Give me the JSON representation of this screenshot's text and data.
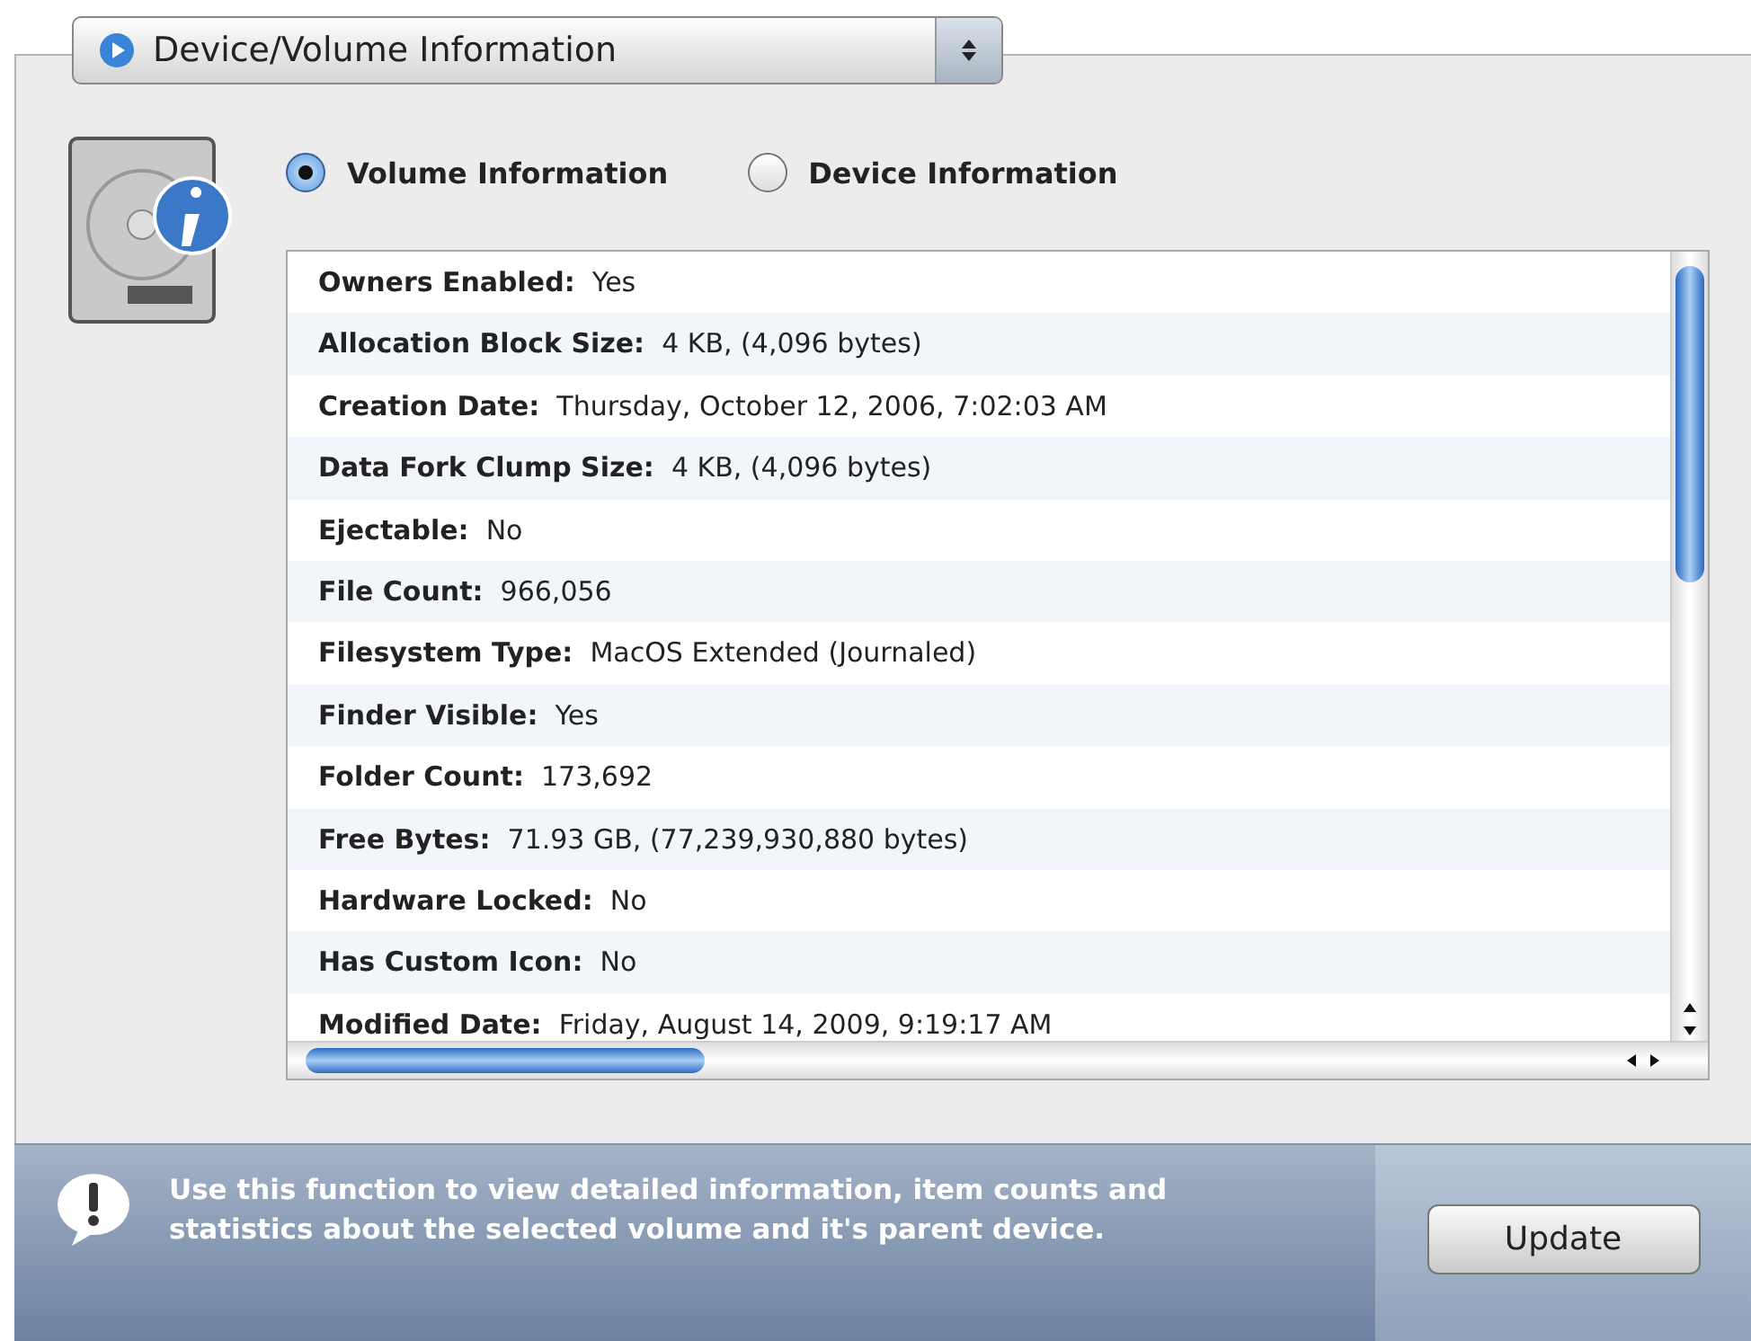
{
  "dropdown": {
    "label": "Device/Volume Information"
  },
  "radios": [
    {
      "label": "Volume Information",
      "selected": true
    },
    {
      "label": "Device Information",
      "selected": false
    }
  ],
  "info_rows": [
    {
      "label": "Owners Enabled:",
      "value": "Yes"
    },
    {
      "label": "Allocation Block Size:",
      "value": "4 KB, (4,096 bytes)"
    },
    {
      "label": "Creation Date:",
      "value": "Thursday, October 12, 2006, 7:02:03 AM"
    },
    {
      "label": "Data Fork Clump Size:",
      "value": "4 KB, (4,096 bytes)"
    },
    {
      "label": "Ejectable:",
      "value": "No"
    },
    {
      "label": "File Count:",
      "value": "966,056"
    },
    {
      "label": "Filesystem Type:",
      "value": "MacOS Extended (Journaled)"
    },
    {
      "label": "Finder Visible:",
      "value": "Yes"
    },
    {
      "label": "Folder Count:",
      "value": "173,692"
    },
    {
      "label": "Free Bytes:",
      "value": "71.93 GB, (77,239,930,880 bytes)"
    },
    {
      "label": "Hardware Locked:",
      "value": "No"
    },
    {
      "label": "Has Custom Icon:",
      "value": "No"
    },
    {
      "label": "Modified Date:",
      "value": "Friday, August 14, 2009, 9:19:17 AM"
    }
  ],
  "footer": {
    "message": "Use this function to view detailed information, item counts and statistics about the selected volume and it's parent device.",
    "button": "Update"
  }
}
